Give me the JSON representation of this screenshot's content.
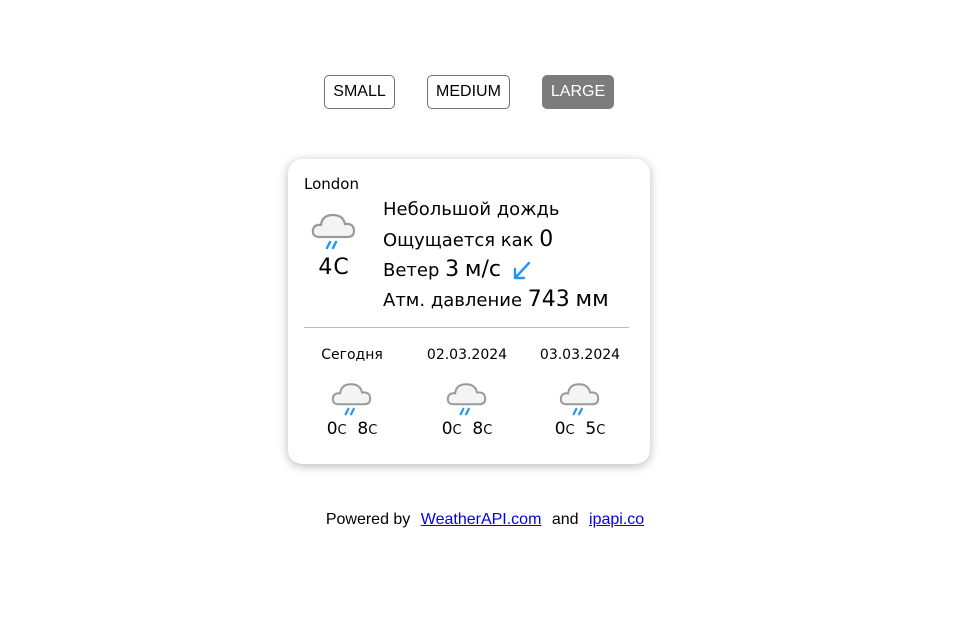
{
  "size_buttons": [
    {
      "label": "SMALL",
      "active": false
    },
    {
      "label": "MEDIUM",
      "active": false
    },
    {
      "label": "LARGE",
      "active": true
    }
  ],
  "weather": {
    "city": "London",
    "icon": "cloud-rain-icon",
    "temp_value": "4",
    "temp_unit": "C",
    "description": "Небольшой дождь",
    "feels_label": "Ощущается как",
    "feels_value": "0",
    "wind_label": "Ветер",
    "wind_value": "3",
    "wind_unit": "м/с",
    "wind_icon": "wind-direction-arrow-icon",
    "pressure_label": "Атм. давление",
    "pressure_value": "743",
    "pressure_unit": "мм"
  },
  "forecast": [
    {
      "label": "Сегодня",
      "icon": "cloud-rain-icon",
      "min": "0",
      "max": "8",
      "unit": "C"
    },
    {
      "label": "02.03.2024",
      "icon": "cloud-rain-icon",
      "min": "0",
      "max": "8",
      "unit": "C"
    },
    {
      "label": "03.03.2024",
      "icon": "cloud-rain-icon",
      "min": "0",
      "max": "5",
      "unit": "C"
    }
  ],
  "footer": {
    "prefix": "Powered by",
    "link1": "WeatherAPI.com",
    "joiner": "and",
    "link2": "ipapi.co"
  },
  "colors": {
    "active_button": "#7c7c7c",
    "rain_drops": "#2196f3",
    "link": "#0000ee"
  }
}
